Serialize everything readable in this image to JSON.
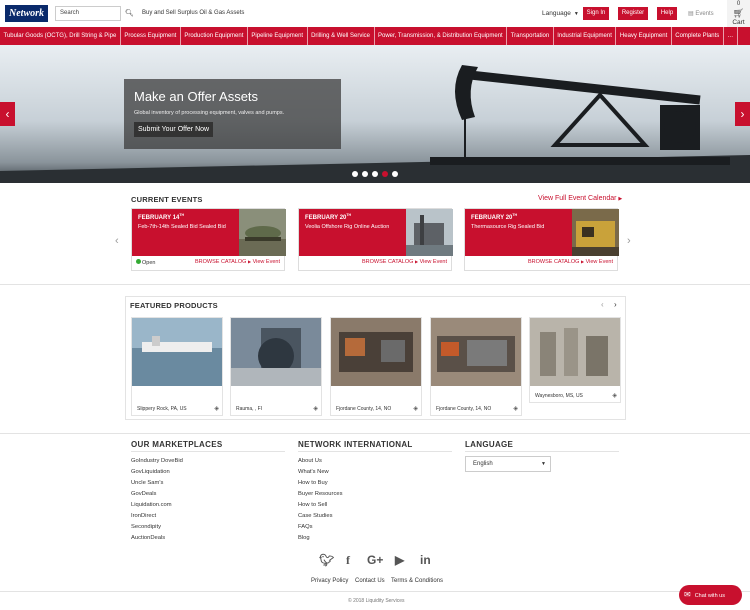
{
  "header": {
    "logo_text": "Network",
    "logo_sub": "INTERNATIONAL",
    "search_placeholder": "Search",
    "tagline": "Buy and Sell Surplus Oil & Gas Assets",
    "language_label": "Language",
    "sign_in": "Sign In",
    "register": "Register",
    "help": "Help",
    "events": "Events",
    "cart_count": "0",
    "cart_label": "Cart"
  },
  "nav": {
    "items": [
      "Tubular Goods (OCTG), Drill String & Pipe",
      "Process Equipment",
      "Production Equipment",
      "Pipeline Equipment",
      "Drilling & Well Service",
      "Power, Transmission, & Distribution Equipment",
      "Transportation",
      "Industrial Equipment",
      "Heavy Equipment",
      "Complete Plants",
      "…"
    ]
  },
  "hero": {
    "title": "Make an Offer Assets",
    "subtitle": "Global inventory of processing equipment, valves and pumps.",
    "button": "Submit Your Offer Now",
    "slide_count": 5,
    "active_slide": 4
  },
  "current_events": {
    "heading": "CURRENT EVENTS",
    "view_full": "View Full Event Calendar",
    "events": [
      {
        "month": "FEBRUARY",
        "day": "14",
        "suffix": "TH",
        "name": "Feb-7th-14th Sealed Bid Sealed Bid",
        "status": "Open",
        "browse": "BROWSE CATALOG",
        "view": "View Event"
      },
      {
        "month": "FEBRUARY",
        "day": "20",
        "suffix": "TH",
        "name": "Veolia Offshore Rig Online Auction",
        "status": "",
        "browse": "BROWSE CATALOG",
        "view": "View Event"
      },
      {
        "month": "FEBRUARY",
        "day": "20",
        "suffix": "TH",
        "name": "Thermasource Rig Sealed Bid",
        "status": "",
        "browse": "BROWSE CATALOG",
        "view": "View Event"
      }
    ]
  },
  "featured": {
    "heading": "FEATURED PRODUCTS",
    "products": [
      {
        "location": "Slippery Rock, PA, US"
      },
      {
        "location": "Rauma, , FI"
      },
      {
        "location": "Fjordane County, 14, NO"
      },
      {
        "location": "Fjordane County, 14, NO"
      },
      {
        "location": "Waynesboro, MS, US"
      }
    ]
  },
  "footer": {
    "marketplaces_heading": "OUR MARKETPLACES",
    "marketplaces": [
      "GoIndustry DoveBid",
      "GovLiquidation",
      "Uncle Sam's",
      "GovDeals",
      "Liquidation.com",
      "IronDirect",
      "Secondipity",
      "AuctionDeals"
    ],
    "network_heading": "NETWORK INTERNATIONAL",
    "network_links": [
      "About Us",
      "What's New",
      "How to Buy",
      "Buyer Resources",
      "How to Sell",
      "Case Studies",
      "FAQs",
      "Blog"
    ],
    "language_heading": "LANGUAGE",
    "language_value": "English",
    "bottom_links": [
      "Privacy Policy",
      "Contact Us",
      "Terms & Conditions"
    ],
    "copyright": "© 2018 Liquidity Services",
    "chat": "Chat with us"
  }
}
